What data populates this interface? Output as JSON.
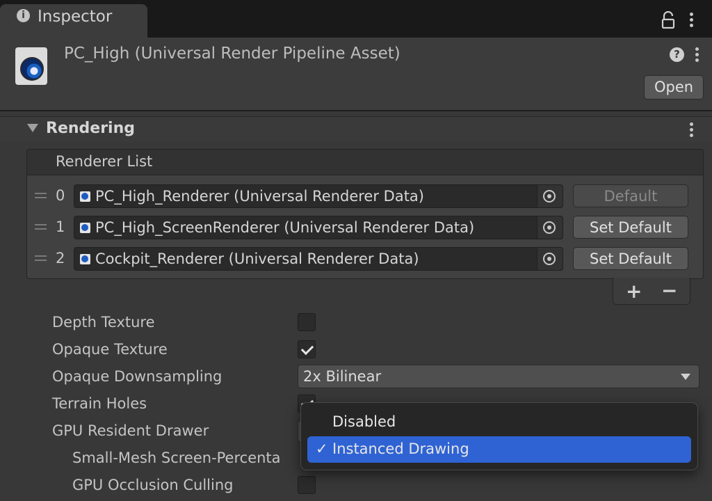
{
  "tab": {
    "title": "Inspector",
    "info_glyph": "i"
  },
  "header": {
    "title": "PC_High (Universal Render Pipeline Asset)",
    "help_glyph": "?",
    "open_label": "Open"
  },
  "section": {
    "title": "Rendering"
  },
  "renderer_list": {
    "header": "Renderer List",
    "rows": [
      {
        "index": "0",
        "name": "PC_High_Renderer (Universal Renderer Data)",
        "button": "Default",
        "button_disabled": true
      },
      {
        "index": "1",
        "name": "PC_High_ScreenRenderer (Universal Renderer Data)",
        "button": "Set Default",
        "button_disabled": false
      },
      {
        "index": "2",
        "name": "Cockpit_Renderer (Universal Renderer Data)",
        "button": "Set Default",
        "button_disabled": false
      }
    ],
    "add_label": "+",
    "remove_label": "−"
  },
  "properties": {
    "depth_texture": {
      "label": "Depth Texture",
      "checked": false
    },
    "opaque_texture": {
      "label": "Opaque Texture",
      "checked": true
    },
    "opaque_downsampling": {
      "label": "Opaque Downsampling",
      "value": "2x Bilinear"
    },
    "terrain_holes": {
      "label": "Terrain Holes",
      "checked": true
    },
    "gpu_resident_drawer": {
      "label": "GPU Resident Drawer"
    },
    "small_mesh": {
      "label": "Small-Mesh Screen-Percenta"
    },
    "gpu_occlusion": {
      "label": "GPU Occlusion Culling",
      "checked": false
    }
  },
  "popup_menu": {
    "items": [
      {
        "label": "Disabled",
        "selected": false
      },
      {
        "label": "Instanced Drawing",
        "selected": true
      }
    ],
    "check_glyph": "✓"
  },
  "colors": {
    "accent": "#2f63d4",
    "panel": "#383838",
    "tabstrip": "#191919"
  }
}
